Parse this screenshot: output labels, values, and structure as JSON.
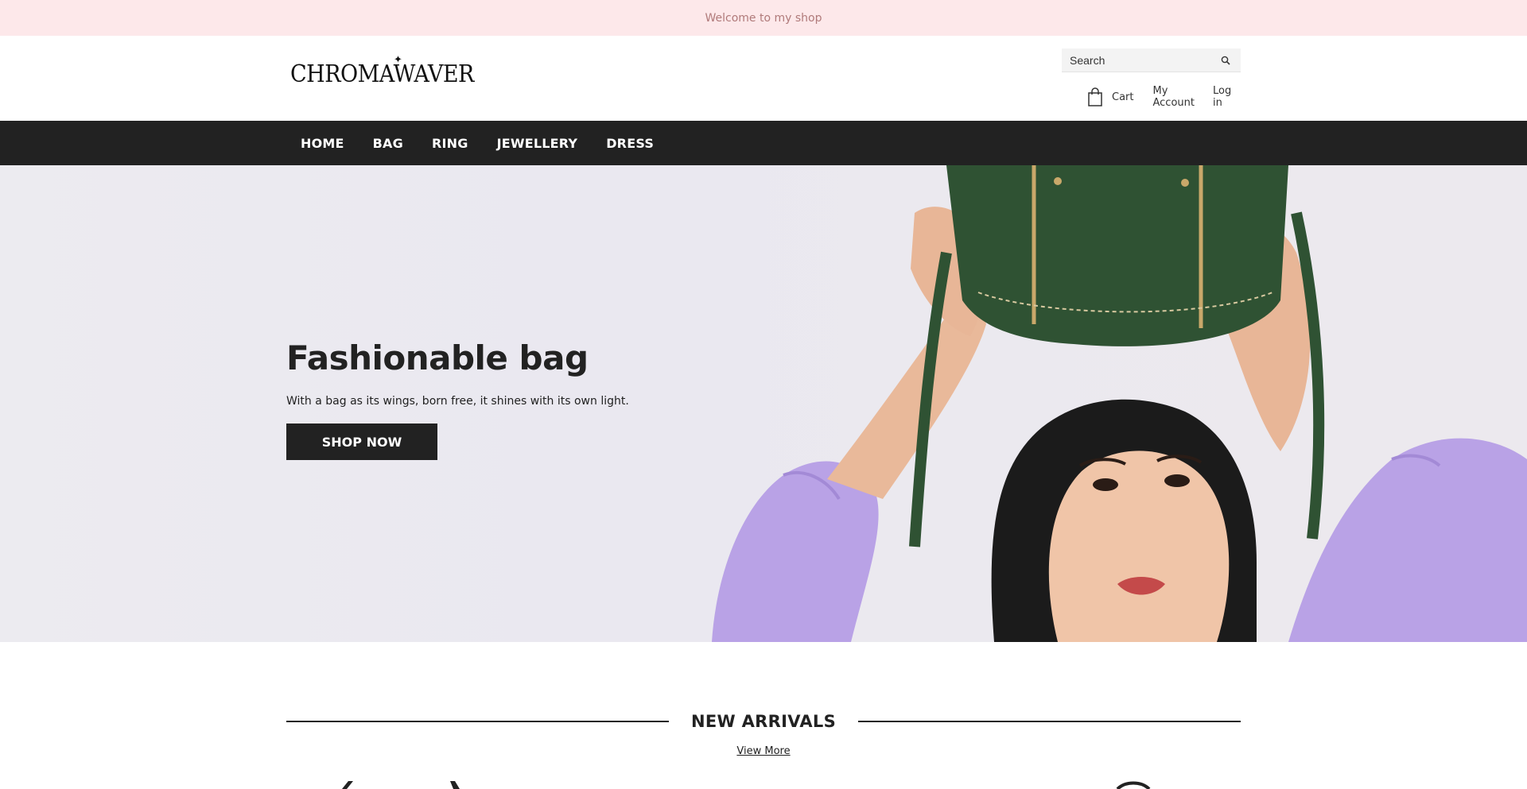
{
  "announcement": {
    "text": "Welcome to my shop"
  },
  "header": {
    "logo": "CHROMAWAVER",
    "search": {
      "placeholder": "Search",
      "value": ""
    },
    "cart_label": "Cart",
    "account_label": "My Account",
    "login_label": "Log in"
  },
  "nav": {
    "items": [
      "HOME",
      "BAG",
      "RING",
      "JEWELLERY",
      "DRESS"
    ]
  },
  "hero": {
    "title": "Fashionable bag",
    "subtitle": "With a bag as its wings, born free, it shines with its own light.",
    "button_label": "SHOP NOW"
  },
  "arrivals": {
    "title": "NEW ARRIVALS",
    "view_more": "View More"
  },
  "colors": {
    "announcement_bg": "#fde8ea",
    "nav_bg": "#222222",
    "button_bg": "#222222",
    "bag_green": "#2f5233",
    "sleeve_lilac": "#b9a2e6"
  }
}
